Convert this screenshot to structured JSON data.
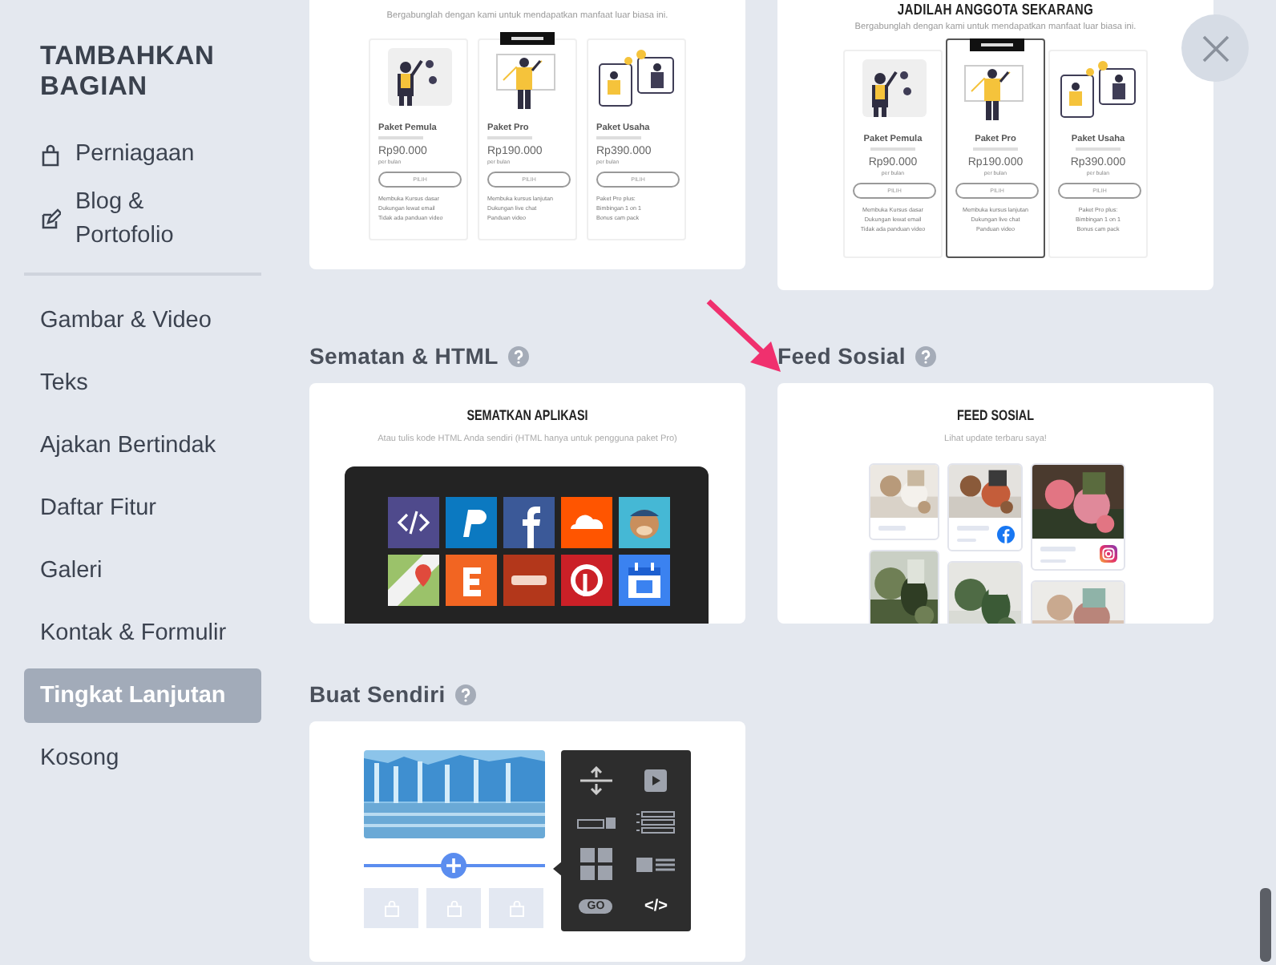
{
  "sidebar": {
    "title": "TAMBAHKAN BAGIAN",
    "shortcuts": [
      {
        "kind": "bag",
        "label": "Perniagaan"
      },
      {
        "kind": "edit",
        "label": "Blog & Portofolio"
      }
    ],
    "items": [
      {
        "label": "Gambar & Video",
        "selected": false
      },
      {
        "label": "Teks",
        "selected": false
      },
      {
        "label": "Ajakan Bertindak",
        "selected": false
      },
      {
        "label": "Daftar Fitur",
        "selected": false
      },
      {
        "label": "Galeri",
        "selected": false
      },
      {
        "label": "Kontak & Formulir",
        "selected": false
      },
      {
        "label": "Tingkat Lanjutan",
        "selected": true
      },
      {
        "label": "Kosong",
        "selected": false
      }
    ]
  },
  "previews": [
    {
      "subtitle": "Bergabunglah dengan kami untuk mendapatkan manfaat luar biasa ini.",
      "plans": [
        {
          "name": "Paket Pemula",
          "price": "Rp90.000",
          "period": "per bulan",
          "button": "PILIH",
          "features": [
            "Membuka Kursus dasar",
            "Dukungan lewat email",
            "Tidak ada panduan video"
          ],
          "featured": false,
          "outlined": false
        },
        {
          "name": "Paket Pro",
          "price": "Rp190.000",
          "period": "per bulan",
          "button": "PILIH",
          "features": [
            "Membuka kursus lanjutan",
            "Dukungan live chat",
            "Panduan video"
          ],
          "featured": true,
          "outlined": false
        },
        {
          "name": "Paket Usaha",
          "price": "Rp390.000",
          "period": "per bulan",
          "button": "PILIH",
          "features": [
            "Paket Pro plus:",
            "Bimbingan 1 on 1",
            "Bonus cam pack"
          ],
          "featured": false,
          "outlined": false
        }
      ]
    },
    {
      "heading": "JADILAH ANGGOTA SEKARANG",
      "subtitle": "Bergabunglah dengan kami untuk mendapatkan manfaat luar biasa ini.",
      "plans": [
        {
          "name": "Paket Pemula",
          "price": "Rp90.000",
          "period": "per bulan",
          "button": "PILIH",
          "features": [
            "Membuka Kursus dasar",
            "Dukungan lewat email",
            "Tidak ada panduan video"
          ],
          "featured": false,
          "outlined": false
        },
        {
          "name": "Paket Pro",
          "price": "Rp190.000",
          "period": "per bulan",
          "button": "PILIH",
          "features": [
            "Membuka kursus lanjutan",
            "Dukungan live chat",
            "Panduan video"
          ],
          "featured": true,
          "outlined": true
        },
        {
          "name": "Paket Usaha",
          "price": "Rp390.000",
          "period": "per bulan",
          "button": "PILIH",
          "features": [
            "Paket Pro plus:",
            "Bimbingan 1 on 1",
            "Bonus cam pack"
          ],
          "featured": false,
          "outlined": false
        }
      ]
    }
  ],
  "sections": [
    {
      "kind": "embed",
      "title": "Sematan & HTML",
      "heading": "SEMATKAN APLIKASI",
      "subtitle": "Atau tulis kode HTML Anda sendiri (HTML hanya untuk pengguna paket Pro)"
    },
    {
      "kind": "feed",
      "title": "Feed Sosial",
      "heading": "FEED SOSIAL",
      "subtitle": "Lihat update terbaru saya!"
    },
    {
      "kind": "custom",
      "title": "Buat Sendiri",
      "tools": [
        {
          "kind": "spacer"
        },
        {
          "kind": "video"
        },
        {
          "kind": "button"
        },
        {
          "kind": "list"
        },
        {
          "kind": "gallery"
        },
        {
          "kind": "media-text"
        },
        {
          "kind": "go",
          "label": "GO"
        },
        {
          "kind": "code",
          "label": "</>"
        }
      ]
    }
  ]
}
